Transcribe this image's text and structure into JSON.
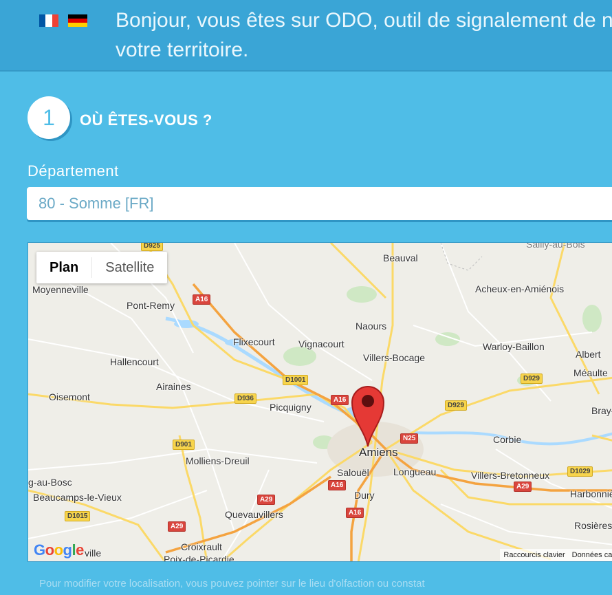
{
  "header": {
    "flags": [
      {
        "name": "french-flag-icon",
        "colors": [
          "#0055a4",
          "#ffffff",
          "#ef4135"
        ]
      },
      {
        "name": "german-flag-icon",
        "colors": [
          "#000000",
          "#dd0000",
          "#ffce00"
        ]
      }
    ],
    "line1": "Bonjour, vous êtes sur ODO, outil de signalement de n",
    "line2": "votre territoire."
  },
  "step": {
    "number": "1",
    "title": "OÙ ÊTES-VOUS ?"
  },
  "department": {
    "label": "Département",
    "value": "80 - Somme [FR]"
  },
  "map": {
    "type_buttons": {
      "plan": "Plan",
      "satellite": "Satellite"
    },
    "places": {
      "sailly": "Sailly-au-Bois",
      "beauval": "Beauval",
      "moyenneville": "Moyenneville",
      "acheux": "Acheux-en-Amiénois",
      "pont_remy": "Pont-Remy",
      "naours": "Naours",
      "flixecourt": "Flixecourt",
      "vignacourt": "Vignacourt",
      "warloy": "Warloy-Baillon",
      "hallencourt": "Hallencourt",
      "villers_bocage": "Villers-Bocage",
      "albert": "Albert",
      "meaulte": "Méaulte",
      "airaines": "Airaines",
      "oisemont": "Oisemont",
      "picquigny": "Picquigny",
      "bray": "Bray-",
      "corbie": "Corbie",
      "amiens": "Amiens",
      "molliens": "Molliens-Dreuil",
      "salouel": "Salouël",
      "longueau": "Longueau",
      "villers_bretonneux": "Villers-Bretonneux",
      "gaubosc": "g-au-Bosc",
      "beaucamps": "Beaucamps-le-Vieux",
      "harbonnieres": "Harbonniè",
      "dury": "Dury",
      "quevauvillers": "Quevauvillers",
      "rosieres": "Rosières",
      "croixrault": "Croixrault",
      "poix": "Poix-de-Picardie",
      "ville": "ville"
    },
    "roads": {
      "d925": "D925",
      "a16a": "A16",
      "d1001": "D1001",
      "a16b": "A16",
      "d936": "D936",
      "d929a": "D929",
      "d929b": "D929",
      "n25": "N25",
      "d901": "D901",
      "a16c": "A16",
      "a29a": "A29",
      "a29b": "A29",
      "d1029": "D1029",
      "a16d": "A16",
      "d1015": "D1015",
      "a29c": "A29"
    },
    "google_logo": [
      "G",
      "o",
      "o",
      "g",
      "l",
      "e"
    ],
    "google_colors": [
      "#4285f4",
      "#ea4335",
      "#fbbc05",
      "#4285f4",
      "#34a853",
      "#ea4335"
    ],
    "footer": {
      "shortcuts": "Raccourcis clavier",
      "data": "Données car"
    },
    "marker_color": "#e53935"
  },
  "hint": "Pour modifier votre localisation, vous pouvez pointer sur le lieu d'olfaction ou constat"
}
